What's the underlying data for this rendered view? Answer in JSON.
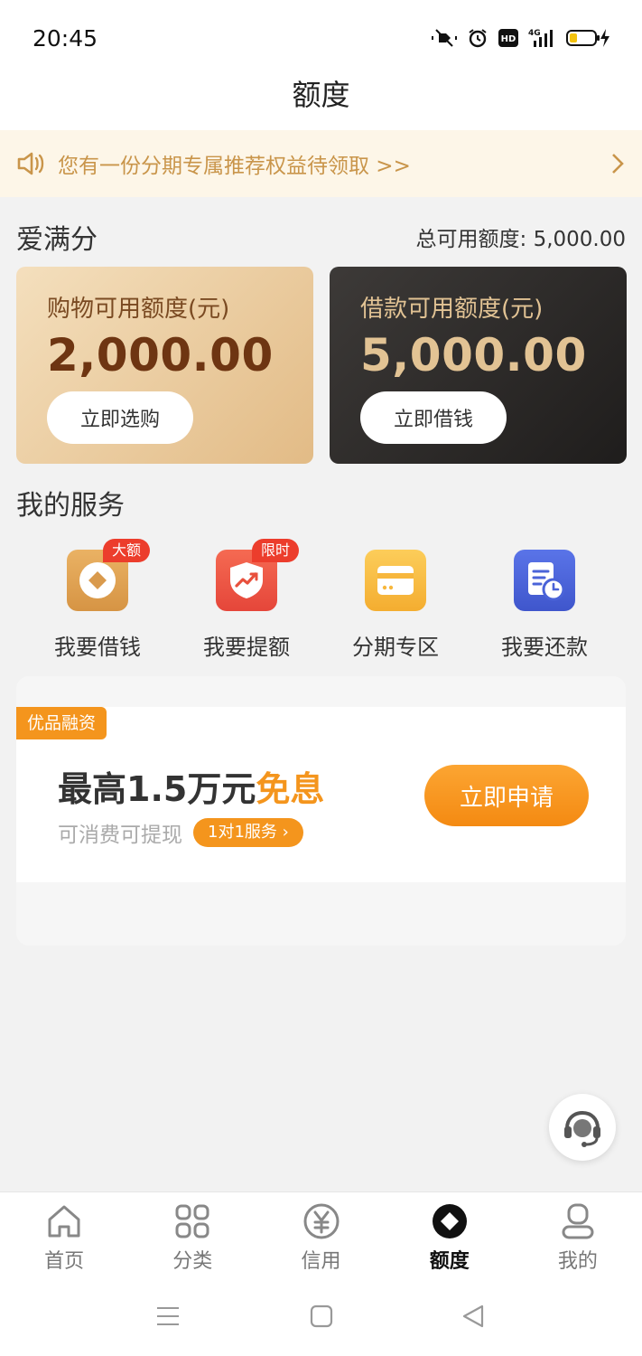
{
  "status_bar": {
    "time": "20:45"
  },
  "header": {
    "title": "额度"
  },
  "notice": {
    "text": "您有一份分期专属推荐权益待领取 >>"
  },
  "credit": {
    "brand": "爱满分",
    "total_label": "总可用额度: 5,000.00",
    "shopping": {
      "label": "购物可用额度(元)",
      "amount": "2,000.00",
      "button": "立即选购"
    },
    "loan": {
      "label": "借款可用额度(元)",
      "amount": "5,000.00",
      "button": "立即借钱"
    }
  },
  "services": {
    "title": "我的服务",
    "items": [
      {
        "label": "我要借钱",
        "tag": "大额",
        "icon": "coin-diamond-icon",
        "color": "#e0a454"
      },
      {
        "label": "我要提额",
        "tag": "限时",
        "icon": "shield-trend-icon",
        "color": "#ef5a45"
      },
      {
        "label": "分期专区",
        "tag": "",
        "icon": "card-icon",
        "color": "#f8bf45"
      },
      {
        "label": "我要还款",
        "tag": "",
        "icon": "bill-clock-icon",
        "color": "#4a63d8"
      }
    ]
  },
  "promo": {
    "badge": "优品融资",
    "headline_prefix": "最高1.5万元",
    "headline_highlight": "免息",
    "subtext": "可消费可提现",
    "pill": "1对1服务 ›",
    "apply_button": "立即申请"
  },
  "tabbar": {
    "items": [
      {
        "label": "首页",
        "icon": "home-icon"
      },
      {
        "label": "分类",
        "icon": "grid-icon"
      },
      {
        "label": "信用",
        "icon": "yuan-circle-icon"
      },
      {
        "label": "额度",
        "icon": "diamond-circle-icon",
        "active": true
      },
      {
        "label": "我的",
        "icon": "user-icon"
      }
    ]
  },
  "colors": {
    "accent": "#f4951d",
    "gold": "#c9954a",
    "dark_card": "#2b2928"
  }
}
